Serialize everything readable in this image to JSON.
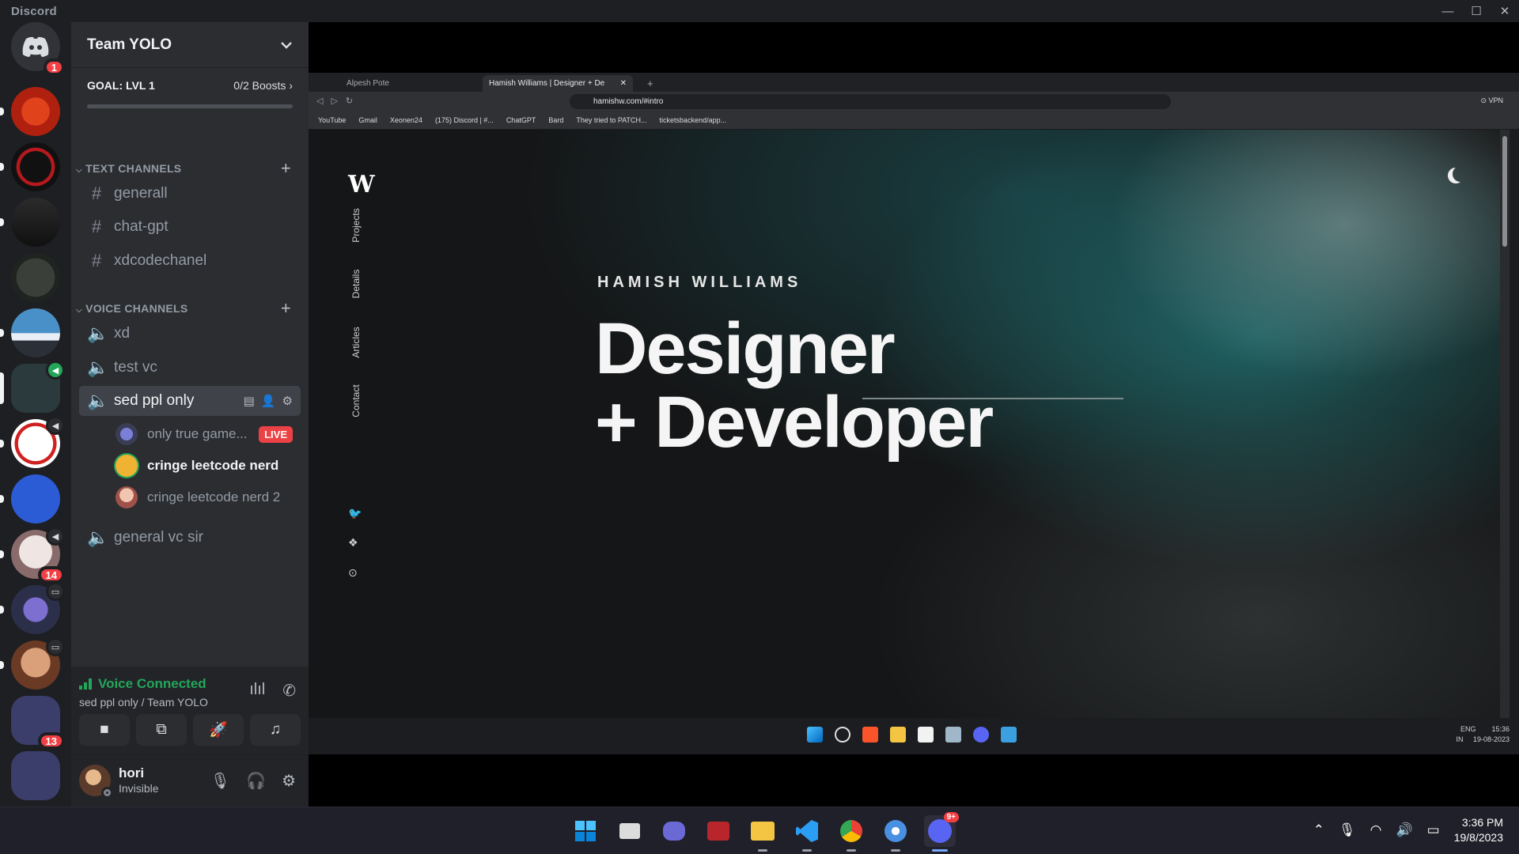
{
  "app": {
    "title": "Discord"
  },
  "window_controls": {
    "minimize": "—",
    "maximize": "☐",
    "close": "✕"
  },
  "rail": {
    "home_badge": "1",
    "badges": {
      "server_10": "14",
      "server_13": "13"
    }
  },
  "server": {
    "name": "Team YOLO",
    "goal_label": "GOAL: LVL 1",
    "boosts": "0/2 Boosts",
    "boost_progress": 0
  },
  "text_channels": {
    "header": "TEXT CHANNELS",
    "items": [
      {
        "name": "generall"
      },
      {
        "name": "chat-gpt"
      },
      {
        "name": "xdcodechanel"
      }
    ]
  },
  "voice_channels": {
    "header": "VOICE CHANNELS",
    "items": [
      {
        "name": "xd"
      },
      {
        "name": "test vc"
      },
      {
        "name": "sed ppl only"
      },
      {
        "name": "general vc sir"
      }
    ],
    "members": [
      {
        "name": "only true game...",
        "live": "LIVE"
      },
      {
        "name": "cringe leetcode nerd"
      },
      {
        "name": "cringe leetcode nerd 2"
      }
    ]
  },
  "voice_panel": {
    "status": "Voice Connected",
    "location": "sed ppl only / Team YOLO"
  },
  "user": {
    "name": "hori",
    "status": "Invisible"
  },
  "browser": {
    "tabs": [
      {
        "label": "Alpesh Pote"
      },
      {
        "label": "Hamish Williams | Designer + De"
      }
    ],
    "url": "hamishw.com/#intro",
    "vpn": "VPN",
    "bookmarks": [
      "YouTube",
      "Gmail",
      "Xeonen24",
      "(175) Discord | #...",
      "ChatGPT",
      "Bard",
      "They tried to PATCH...",
      "ticketsbackend/app..."
    ]
  },
  "site": {
    "logo": "W",
    "nav": [
      "Projects",
      "Details",
      "Articles",
      "Contact"
    ],
    "name": "HAMISH WILLIAMS",
    "line1": "Designer",
    "line2": "+ Developer"
  },
  "stream_tray": {
    "lang1": "ENG",
    "lang2": "IN",
    "time": "15:36",
    "date": "19-08-2023"
  },
  "taskbar": {
    "time": "3:36 PM",
    "date": "19/8/2023",
    "discord_badge": "9+"
  },
  "colors": {
    "green": "#23a55a",
    "red": "#f23f43",
    "blurple": "#5865f2"
  }
}
